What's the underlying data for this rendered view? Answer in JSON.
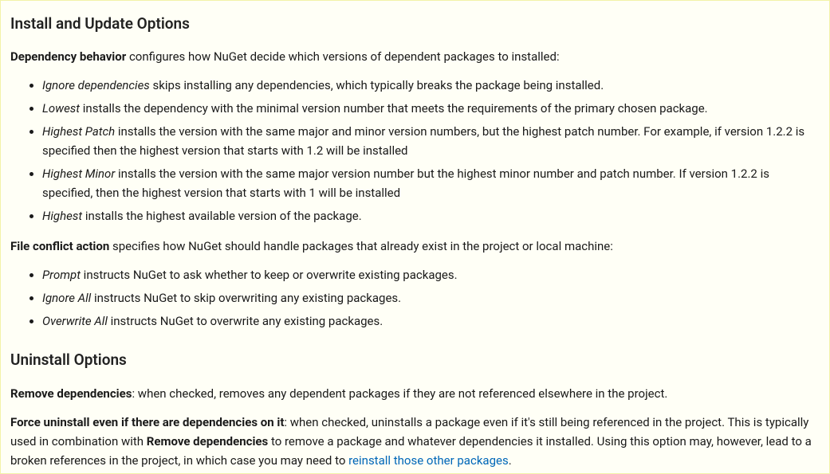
{
  "section1": {
    "heading": "Install and Update Options",
    "intro_bold": "Dependency behavior",
    "intro_rest": " configures how NuGet decide which versions of dependent packages to installed:",
    "dep_items": [
      {
        "term": "Ignore dependencies",
        "rest": " skips installing any dependencies, which typically breaks the package being installed."
      },
      {
        "term": "Lowest",
        "rest": " installs the dependency with the minimal version number that meets the requirements of the primary chosen package."
      },
      {
        "term": "Highest Patch",
        "rest": " installs the version with the same major and minor version numbers, but the highest patch number. For example, if version 1.2.2 is specified then the highest version that starts with 1.2 will be installed"
      },
      {
        "term": "Highest Minor",
        "rest": " installs the version with the same major version number but the highest minor number and patch number. If version 1.2.2 is specified, then the highest version that starts with 1 will be installed"
      },
      {
        "term": "Highest",
        "rest": " installs the highest available version of the package."
      }
    ],
    "file_conflict_bold": "File conflict action",
    "file_conflict_rest": " specifies how NuGet should handle packages that already exist in the project or local machine:",
    "file_items": [
      {
        "term": "Prompt",
        "rest": " instructs NuGet to ask whether to keep or overwrite existing packages."
      },
      {
        "term": "Ignore All",
        "rest": " instructs NuGet to skip overwriting any existing packages."
      },
      {
        "term": "Overwrite All",
        "rest": " instructs NuGet to overwrite any existing packages."
      }
    ]
  },
  "section2": {
    "heading": "Uninstall Options",
    "remove_bold": "Remove dependencies",
    "remove_rest": ": when checked, removes any dependent packages if they are not referenced elsewhere in the project.",
    "force_bold": "Force uninstall even if there are dependencies on it",
    "force_rest1": ": when checked, uninstalls a package even if it's still being referenced in the project. This is typically used in combination with ",
    "force_inner_bold": "Remove dependencies",
    "force_rest2": " to remove a package and whatever dependencies it installed. Using this option may, however, lead to a broken references in the project, in which case you may need to ",
    "force_link": "reinstall those other packages",
    "force_rest3": "."
  }
}
